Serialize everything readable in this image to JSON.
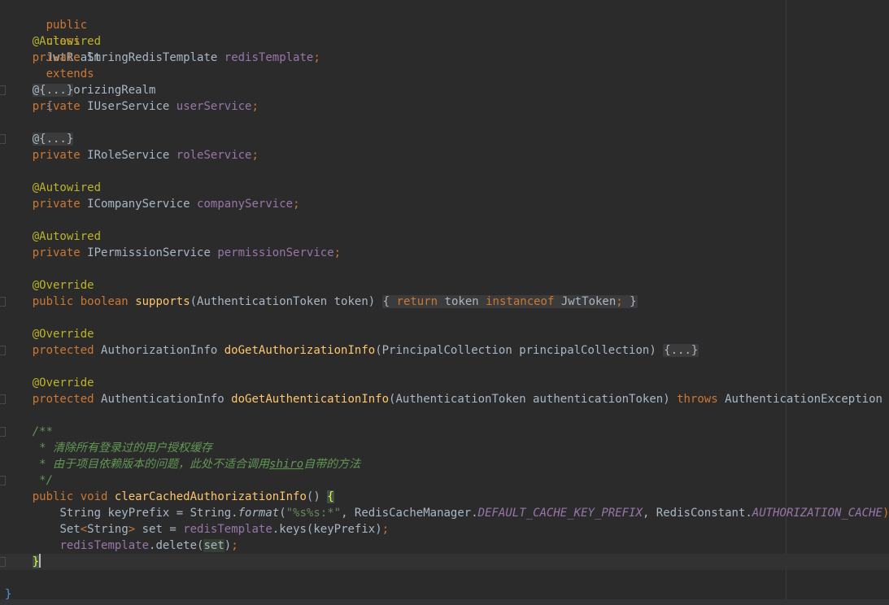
{
  "editor": {
    "class_decl": {
      "kw_public": "public",
      "kw_class": "class",
      "class_name": "JwtRealm",
      "kw_extends": "extends",
      "parent": "AuthorizingRealm",
      "open_brace": "{"
    },
    "autowired": "@Autowired",
    "override": "@Override",
    "collapsed_annotation": "@{...}",
    "kw_private": "private",
    "kw_public": "public",
    "kw_protected": "protected",
    "fields": [
      {
        "type": "StringRedisTemplate",
        "name": "redisTemplate",
        "semicolon": ";"
      },
      {
        "type": "IUserService",
        "name": "userService",
        "semicolon": ";"
      },
      {
        "type": "IRoleService",
        "name": "roleService",
        "semicolon": ";"
      },
      {
        "type": "ICompanyService",
        "name": "companyService",
        "semicolon": ";"
      },
      {
        "type": "IPermissionService",
        "name": "permissionService",
        "semicolon": ";"
      }
    ],
    "supports": {
      "kw_boolean": "boolean",
      "name": "supports",
      "params": "(AuthenticationToken token)",
      "body_open": "{",
      "kw_return": "return",
      "token": "token",
      "kw_instanceof": "instanceof",
      "jwt_token": "JwtToken",
      "semicolon": ";",
      "body_close": "}"
    },
    "authz": {
      "return_type": "AuthorizationInfo",
      "name": "doGetAuthorizationInfo",
      "params": "(PrincipalCollection principalCollection)",
      "folded": "{...}"
    },
    "authn": {
      "return_type": "AuthenticationInfo",
      "name": "doGetAuthenticationInfo",
      "params": "(AuthenticationToken authenticationToken)",
      "kw_throws": "throws",
      "exception": "AuthenticationException",
      "folded": "{...}"
    },
    "javadoc": {
      "open": "/**",
      "line1": " * 清除所有登录过的用户授权缓存",
      "line2_a": " * 由于项目依赖版本的问题，此处不适合调用",
      "line2_u": "shiro",
      "line2_b": "自带的方法",
      "close": " */"
    },
    "clear_method": {
      "kw_void": "void",
      "name": "clearCachedAuthorizationInfo",
      "parens": "()",
      "open_brace": "{",
      "line1": {
        "type": "String",
        "var": "keyPrefix",
        "eq": " = String.",
        "fn": "format",
        "paren": "(",
        "literal": "\"%s%s:*\"",
        "comma1": ", RedisCacheManager.",
        "const1": "DEFAULT_CACHE_KEY_PREFIX",
        "comma2": ", RedisConstant.",
        "const2": "AUTHORIZATION_CACHE",
        "end": ");"
      },
      "line2": {
        "type_a": "Set",
        "lt": "<",
        "type_b": "String",
        "gt": ">",
        "var": " set = ",
        "field": "redisTemplate",
        "call": ".keys(keyPrefix)",
        "end": ";"
      },
      "line3": {
        "field": "redisTemplate",
        "call": ".delete",
        "paren_open": "(",
        "arg": "set",
        "paren_close": ")",
        "end": ";"
      },
      "close_brace": "}"
    },
    "class_close": "}"
  }
}
